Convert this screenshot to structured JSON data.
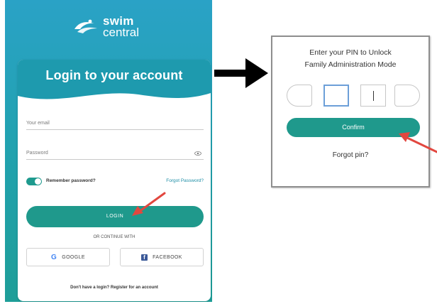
{
  "login": {
    "logo_line1": "swim",
    "logo_line2": "central",
    "title": "Login to your account",
    "email_label": "Your email",
    "password_label": "Password",
    "remember_label": "Remember password?",
    "forgot_password": "Forgot Password?",
    "login_button": "LOGIN",
    "or_continue": "OR CONTINUE WITH",
    "google_button": "GOOGLE",
    "facebook_button": "FACEBOOK",
    "register_text": "Don't have a login? Register for an account"
  },
  "pin": {
    "title_line1": "Enter your PIN to Unlock",
    "title_line2": "Family Administration Mode",
    "confirm_button": "Confirm",
    "forgot_pin": "Forgot pin?"
  },
  "colors": {
    "brand_teal": "#1f998c",
    "header_blue": "#2aa2c6",
    "annotation_arrow": "#e2473f",
    "flow_arrow": "#000000"
  },
  "icons": [
    "swim-logo-icon",
    "eye-icon",
    "google-icon",
    "facebook-icon",
    "flow-arrow-icon",
    "red-pointer-arrow-icon"
  ]
}
